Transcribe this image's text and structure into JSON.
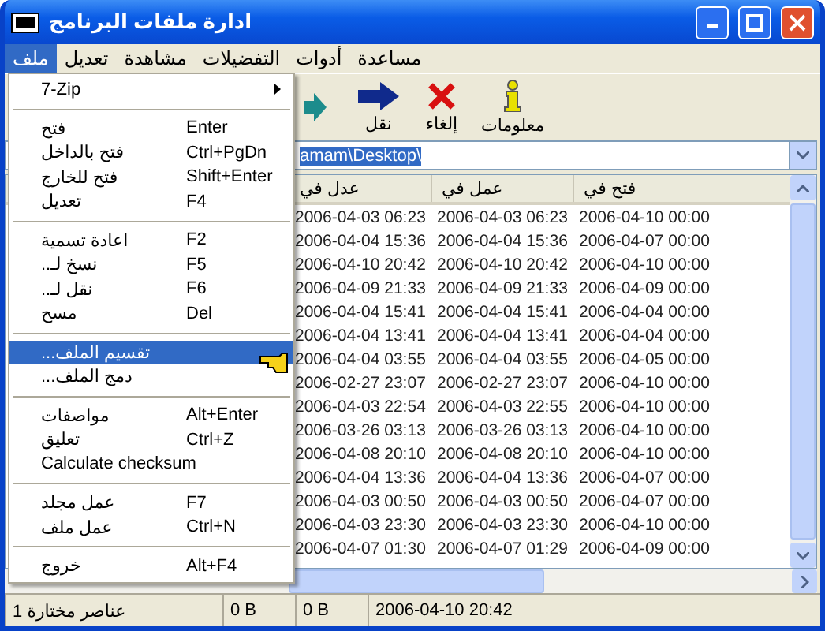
{
  "window": {
    "title": "ادارة ملفات البرنامج"
  },
  "menu_bar": [
    {
      "label": "مساعدة",
      "selected": false
    },
    {
      "label": "أدوات",
      "selected": false
    },
    {
      "label": "التفضيلات",
      "selected": false
    },
    {
      "label": "مشاهدة",
      "selected": false
    },
    {
      "label": "تعديل",
      "selected": false
    },
    {
      "label": "ملف",
      "selected": true
    }
  ],
  "toolbar": [
    {
      "kind": "info",
      "label": "معلومات"
    },
    {
      "kind": "delete",
      "label": "إلغاء"
    },
    {
      "kind": "move",
      "label": "نقل"
    },
    {
      "kind": "copy"
    }
  ],
  "address": {
    "value": "amam\\Desktop\\"
  },
  "table": {
    "columns": [
      "فتح في",
      "عمل في",
      "عدل في"
    ],
    "rows": [
      [
        "2006-04-10 00:00",
        "2006-04-03 06:23",
        "2006-04-03 06:23"
      ],
      [
        "2006-04-07 00:00",
        "2006-04-04 15:36",
        "2006-04-04 15:36"
      ],
      [
        "2006-04-10 00:00",
        "2006-04-10 20:42",
        "2006-04-10 20:42"
      ],
      [
        "2006-04-09 00:00",
        "2006-04-09 21:33",
        "2006-04-09 21:33"
      ],
      [
        "2006-04-04 00:00",
        "2006-04-04 15:41",
        "2006-04-04 15:41"
      ],
      [
        "2006-04-04 00:00",
        "2006-04-04 13:41",
        "2006-04-04 13:41"
      ],
      [
        "2006-04-05 00:00",
        "2006-04-04 03:55",
        "2006-04-04 03:55"
      ],
      [
        "2006-04-10 00:00",
        "2006-02-27 23:07",
        "2006-02-27 23:07"
      ],
      [
        "2006-04-10 00:00",
        "2006-04-03 22:55",
        "2006-04-03 22:54"
      ],
      [
        "2006-04-10 00:00",
        "2006-03-26 03:13",
        "2006-03-26 03:13"
      ],
      [
        "2006-04-10 00:00",
        "2006-04-08 20:10",
        "2006-04-08 20:10"
      ],
      [
        "2006-04-07 00:00",
        "2006-04-04 13:36",
        "2006-04-04 13:36"
      ],
      [
        "2006-04-07 00:00",
        "2006-04-03 00:50",
        "2006-04-03 00:50"
      ],
      [
        "2006-04-10 00:00",
        "2006-04-03 23:30",
        "2006-04-03 23:30"
      ],
      [
        "2006-04-09 00:00",
        "2006-04-07 01:29",
        "2006-04-07 01:30"
      ]
    ]
  },
  "file_menu": [
    {
      "kind": "item",
      "label": "7-Zip",
      "submenu": true,
      "selected": false
    },
    {
      "kind": "separator"
    },
    {
      "kind": "item",
      "label": "فتح",
      "shortcut": "Enter",
      "selected": false
    },
    {
      "kind": "item",
      "label": "فتح بالداخل",
      "shortcut": "Ctrl+PgDn",
      "selected": false
    },
    {
      "kind": "item",
      "label": "فتح للخارج",
      "shortcut": "Shift+Enter",
      "selected": false
    },
    {
      "kind": "item",
      "label": "تعديل",
      "shortcut": "F4",
      "selected": false
    },
    {
      "kind": "separator"
    },
    {
      "kind": "item",
      "label": "اعادة تسمية",
      "shortcut": "F2",
      "selected": false
    },
    {
      "kind": "item",
      "label": "نسخ لـ..",
      "shortcut": "F5",
      "selected": false
    },
    {
      "kind": "item",
      "label": "نقل لـ..",
      "shortcut": "F6",
      "selected": false
    },
    {
      "kind": "item",
      "label": "مسح",
      "shortcut": "Del",
      "selected": false
    },
    {
      "kind": "separator"
    },
    {
      "kind": "item",
      "label": "تقسيم الملف...",
      "selected": true
    },
    {
      "kind": "item",
      "label": "دمج الملف...",
      "selected": false
    },
    {
      "kind": "separator"
    },
    {
      "kind": "item",
      "label": "مواصفات",
      "shortcut": "Alt+Enter",
      "selected": false
    },
    {
      "kind": "item",
      "label": "تعليق",
      "shortcut": "Ctrl+Z",
      "selected": false
    },
    {
      "kind": "item",
      "label": "Calculate checksum",
      "selected": false
    },
    {
      "kind": "separator"
    },
    {
      "kind": "item",
      "label": "عمل مجلد",
      "shortcut": "F7",
      "selected": false
    },
    {
      "kind": "item",
      "label": "عمل ملف",
      "shortcut": "Ctrl+N",
      "selected": false
    },
    {
      "kind": "separator"
    },
    {
      "kind": "item",
      "label": "خروج",
      "shortcut": "Alt+F4",
      "selected": false
    }
  ],
  "status_bar": [
    "2006-04-10 20:42",
    "0 B",
    "0 B",
    "1 عناصر مختارة"
  ]
}
